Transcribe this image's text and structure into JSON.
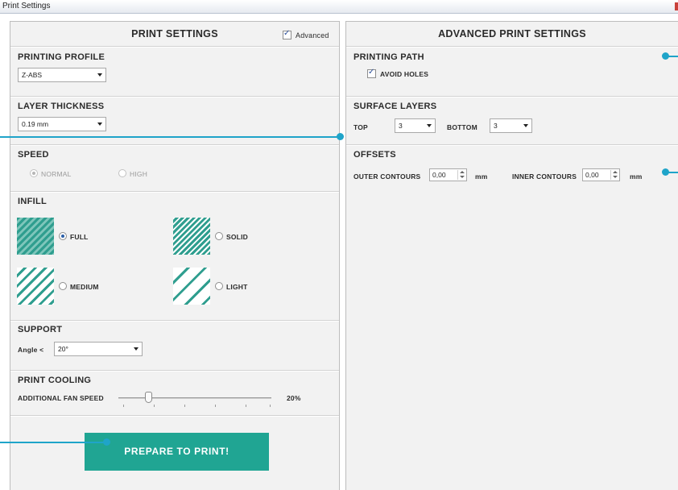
{
  "window": {
    "title": "Print Settings"
  },
  "left": {
    "heading": "PRINT SETTINGS",
    "advanced_label": "Advanced",
    "advanced_checked": true,
    "printing_profile": {
      "title": "PRINTING PROFILE",
      "value": "Z-ABS"
    },
    "layer_thickness": {
      "title": "LAYER THICKNESS",
      "value": "0.19 mm"
    },
    "speed": {
      "title": "SPEED",
      "options": [
        "NORMAL",
        "HIGH"
      ],
      "selected": "NORMAL"
    },
    "infill": {
      "title": "INFILL",
      "options": [
        "FULL",
        "SOLID",
        "MEDIUM",
        "LIGHT"
      ],
      "selected": "FULL"
    },
    "support": {
      "title": "SUPPORT",
      "angle_label": "Angle <",
      "angle_value": "20°"
    },
    "print_cooling": {
      "title": "PRINT COOLING",
      "fan_label": "ADDITIONAL FAN SPEED",
      "fan_value": "20%",
      "fan_level": 0.2
    },
    "prepare_button": "PREPARE TO PRINT!"
  },
  "right": {
    "heading": "ADVANCED PRINT SETTINGS",
    "printing_path": {
      "title": "PRINTING PATH",
      "avoid_holes_label": "AVOID HOLES",
      "avoid_holes_checked": true
    },
    "surface_layers": {
      "title": "SURFACE LAYERS",
      "top_label": "TOP",
      "top_value": "3",
      "bottom_label": "BOTTOM",
      "bottom_value": "3"
    },
    "offsets": {
      "title": "OFFSETS",
      "outer_label": "OUTER CONTOURS",
      "outer_value": "0,00",
      "inner_label": "INNER CONTOURS",
      "inner_value": "0,00",
      "unit": "mm"
    }
  },
  "colors": {
    "accent": "#20a593",
    "callout": "#1fa4c9"
  }
}
